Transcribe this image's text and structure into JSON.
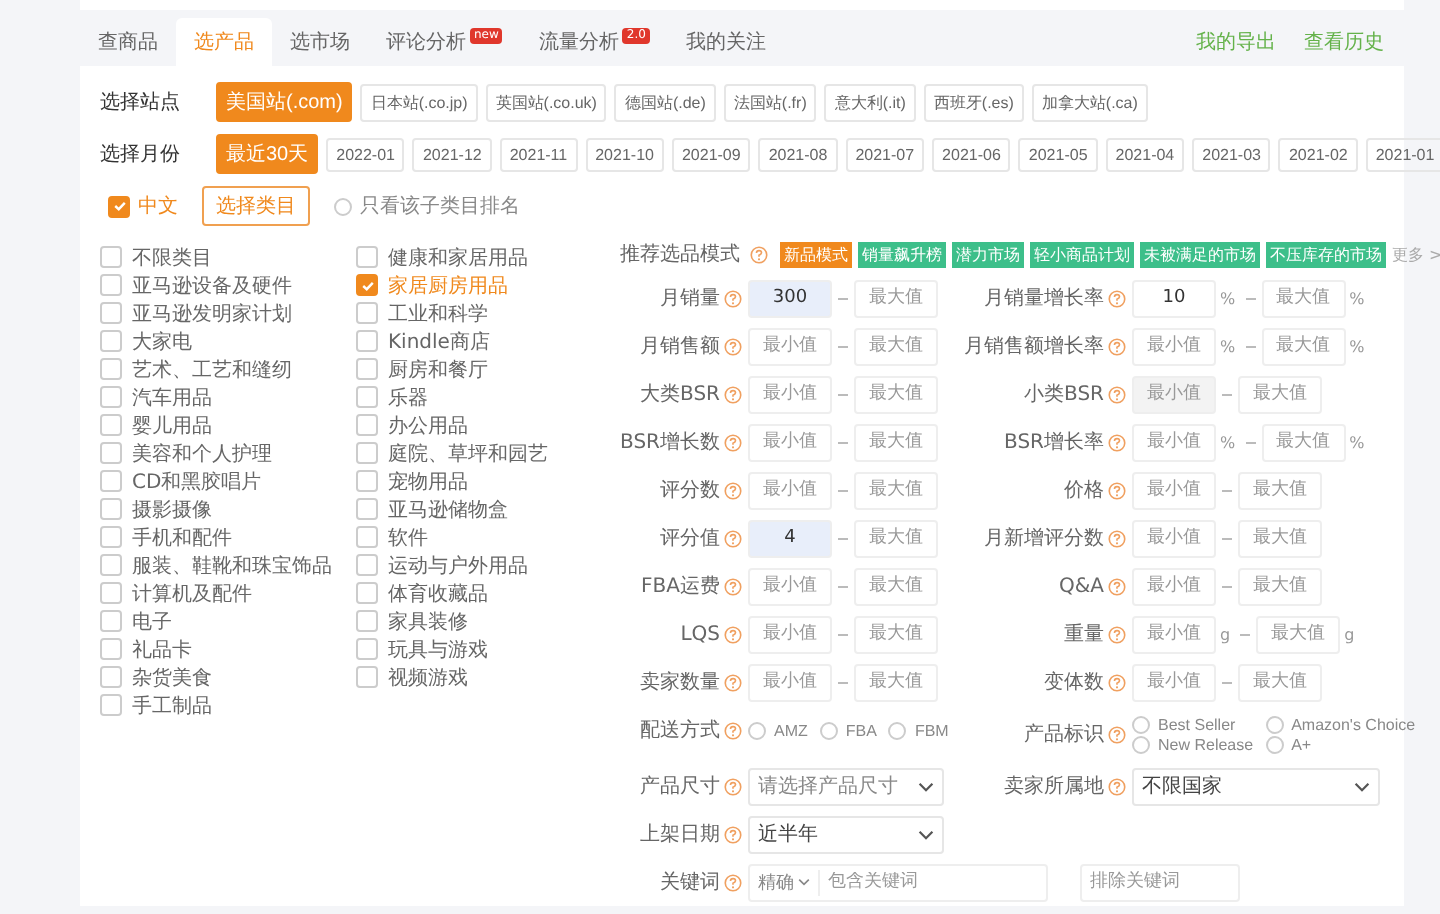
{
  "tabs": [
    {
      "label": "查商品",
      "selected": false
    },
    {
      "label": "选产品",
      "selected": true
    },
    {
      "label": "选市场",
      "selected": false
    },
    {
      "label": "评论分析",
      "selected": false,
      "badge": "new"
    },
    {
      "label": "流量分析",
      "selected": false,
      "badge": "2.0"
    },
    {
      "label": "我的关注",
      "selected": false
    }
  ],
  "header_links": [
    "我的导出",
    "查看历史"
  ],
  "site_filter": {
    "label": "选择站点",
    "options": [
      {
        "label": "美国站(.com)",
        "selected": true
      },
      {
        "label": "日本站(.co.jp)",
        "selected": false
      },
      {
        "label": "英国站(.co.uk)",
        "selected": false
      },
      {
        "label": "德国站(.de)",
        "selected": false
      },
      {
        "label": "法国站(.fr)",
        "selected": false
      },
      {
        "label": "意大利(.it)",
        "selected": false
      },
      {
        "label": "西班牙(.es)",
        "selected": false
      },
      {
        "label": "加拿大站(.ca)",
        "selected": false
      }
    ]
  },
  "month_filter": {
    "label": "选择月份",
    "options": [
      {
        "label": "最近30天",
        "selected": true
      },
      {
        "label": "2022-01",
        "selected": false
      },
      {
        "label": "2021-12",
        "selected": false
      },
      {
        "label": "2021-11",
        "selected": false
      },
      {
        "label": "2021-10",
        "selected": false
      },
      {
        "label": "2021-09",
        "selected": false
      },
      {
        "label": "2021-08",
        "selected": false
      },
      {
        "label": "2021-07",
        "selected": false
      },
      {
        "label": "2021-06",
        "selected": false
      },
      {
        "label": "2021-05",
        "selected": false
      },
      {
        "label": "2021-04",
        "selected": false
      },
      {
        "label": "2021-03",
        "selected": false
      },
      {
        "label": "2021-02",
        "selected": false
      },
      {
        "label": "2021-01",
        "selected": false
      }
    ]
  },
  "language_checkbox": {
    "label": "中文",
    "checked": true
  },
  "category_button": "选择类目",
  "subcategory_radio": {
    "label": "只看该子类目排名",
    "checked": false
  },
  "category_columns": [
    {
      "items": [
        {
          "label": "不限类目",
          "checked": false
        },
        {
          "label": "亚马逊设备及硬件",
          "checked": false
        },
        {
          "label": "亚马逊发明家计划",
          "checked": false
        },
        {
          "label": "大家电",
          "checked": false
        },
        {
          "label": "艺术、工艺和缝纫",
          "checked": false
        },
        {
          "label": "汽车用品",
          "checked": false
        },
        {
          "label": "婴儿用品",
          "checked": false
        },
        {
          "label": "美容和个人护理",
          "checked": false
        },
        {
          "label": "CD和黑胶唱片",
          "checked": false
        },
        {
          "label": "摄影摄像",
          "checked": false
        },
        {
          "label": "手机和配件",
          "checked": false
        },
        {
          "label": "服装、鞋靴和珠宝饰品",
          "checked": false
        },
        {
          "label": "计算机及配件",
          "checked": false
        },
        {
          "label": "电子",
          "checked": false
        },
        {
          "label": "礼品卡",
          "checked": false
        },
        {
          "label": "杂货美食",
          "checked": false
        },
        {
          "label": "手工制品",
          "checked": false
        }
      ]
    },
    {
      "items": [
        {
          "label": "健康和家居用品",
          "checked": false
        },
        {
          "label": "家居厨房用品",
          "checked": true
        },
        {
          "label": "工业和科学",
          "checked": false
        },
        {
          "label": "Kindle商店",
          "checked": false
        },
        {
          "label": "厨房和餐厅",
          "checked": false
        },
        {
          "label": "乐器",
          "checked": false
        },
        {
          "label": "办公用品",
          "checked": false
        },
        {
          "label": "庭院、草坪和园艺",
          "checked": false
        },
        {
          "label": "宠物用品",
          "checked": false
        },
        {
          "label": "亚马逊储物盒",
          "checked": false
        },
        {
          "label": "软件",
          "checked": false
        },
        {
          "label": "运动与户外用品",
          "checked": false
        },
        {
          "label": "体育收藏品",
          "checked": false
        },
        {
          "label": "家具装修",
          "checked": false
        },
        {
          "label": "玩具与游戏",
          "checked": false
        },
        {
          "label": "视频游戏",
          "checked": false
        }
      ]
    }
  ],
  "mode_row": {
    "label": "推荐选品模式",
    "tags": [
      {
        "label": "新品模式",
        "selected": true
      },
      {
        "label": "销量飙升榜",
        "selected": false
      },
      {
        "label": "潜力市场",
        "selected": false
      },
      {
        "label": "轻小商品计划",
        "selected": false
      },
      {
        "label": "未被满足的市场",
        "selected": false
      },
      {
        "label": "不压库存的市场",
        "selected": false
      }
    ],
    "more": "更多 >"
  },
  "fields": [
    {
      "kind": "range",
      "label": "月销量",
      "min": {
        "value": "300",
        "highlighted": true
      },
      "max": {
        "placeholder": "最大值"
      }
    },
    {
      "kind": "range",
      "label": "月销量增长率",
      "min": {
        "value": "10"
      },
      "max": {
        "placeholder": "最大值"
      },
      "min_unit": "%",
      "max_unit": "%"
    },
    {
      "kind": "range",
      "label": "月销售额",
      "min": {
        "placeholder": "最小值"
      },
      "max": {
        "placeholder": "最大值"
      }
    },
    {
      "kind": "range",
      "label": "月销售额增长率",
      "min": {
        "placeholder": "最小值"
      },
      "max": {
        "placeholder": "最大值"
      },
      "min_unit": "%",
      "max_unit": "%"
    },
    {
      "kind": "range",
      "label": "大类BSR",
      "min": {
        "placeholder": "最小值"
      },
      "max": {
        "placeholder": "最大值"
      }
    },
    {
      "kind": "range",
      "label": "小类BSR",
      "min": {
        "placeholder": "最小值",
        "disabled": true
      },
      "max": {
        "placeholder": "最大值"
      }
    },
    {
      "kind": "range",
      "label": "BSR增长数",
      "min": {
        "placeholder": "最小值"
      },
      "max": {
        "placeholder": "最大值"
      }
    },
    {
      "kind": "range",
      "label": "BSR增长率",
      "min": {
        "placeholder": "最小值"
      },
      "max": {
        "placeholder": "最大值"
      },
      "min_unit": "%",
      "max_unit": "%"
    },
    {
      "kind": "range",
      "label": "评分数",
      "min": {
        "placeholder": "最小值"
      },
      "max": {
        "placeholder": "最大值"
      }
    },
    {
      "kind": "range",
      "label": "价格",
      "min": {
        "placeholder": "最小值"
      },
      "max": {
        "placeholder": "最大值"
      }
    },
    {
      "kind": "range",
      "label": "评分值",
      "min": {
        "value": "4",
        "highlighted": true
      },
      "max": {
        "placeholder": "最大值"
      }
    },
    {
      "kind": "range",
      "label": "月新增评分数",
      "min": {
        "placeholder": "最小值"
      },
      "max": {
        "placeholder": "最大值"
      }
    },
    {
      "kind": "range",
      "label": "FBA运费",
      "min": {
        "placeholder": "最小值"
      },
      "max": {
        "placeholder": "最大值"
      }
    },
    {
      "kind": "range",
      "label": "Q&A",
      "min": {
        "placeholder": "最小值"
      },
      "max": {
        "placeholder": "最大值"
      }
    },
    {
      "kind": "range",
      "label": "LQS",
      "min": {
        "placeholder": "最小值"
      },
      "max": {
        "placeholder": "最大值"
      }
    },
    {
      "kind": "range",
      "label": "重量",
      "min": {
        "placeholder": "最小值"
      },
      "max": {
        "placeholder": "最大值"
      },
      "min_unit": "g",
      "max_unit": "g"
    },
    {
      "kind": "range",
      "label": "卖家数量",
      "min": {
        "placeholder": "最小值"
      },
      "max": {
        "placeholder": "最大值"
      }
    },
    {
      "kind": "range",
      "label": "变体数",
      "min": {
        "placeholder": "最小值"
      },
      "max": {
        "placeholder": "最大值"
      }
    },
    {
      "kind": "radios",
      "label": "配送方式",
      "options": [
        {
          "label": "AMZ",
          "selected": false
        },
        {
          "label": "FBA",
          "selected": false
        },
        {
          "label": "FBM",
          "selected": false
        }
      ]
    },
    {
      "kind": "checks",
      "label": "产品标识",
      "options": [
        {
          "label": "Best Seller",
          "checked": false
        },
        {
          "label": "Amazon's Choice",
          "checked": false
        },
        {
          "label": "New Release",
          "checked": false
        },
        {
          "label": "A+",
          "checked": false
        }
      ]
    },
    {
      "kind": "select",
      "label": "产品尺寸",
      "placeholder": "请选择产品尺寸"
    },
    {
      "kind": "select",
      "label": "卖家所属地",
      "value": "不限国家"
    },
    {
      "kind": "select",
      "label": "上架日期",
      "value": "近半年"
    },
    {
      "kind": "keyword",
      "label": "关键词",
      "match": "精确",
      "include": {
        "placeholder": "包含关键词"
      },
      "exclude": {
        "placeholder": "排除关键词"
      }
    }
  ]
}
